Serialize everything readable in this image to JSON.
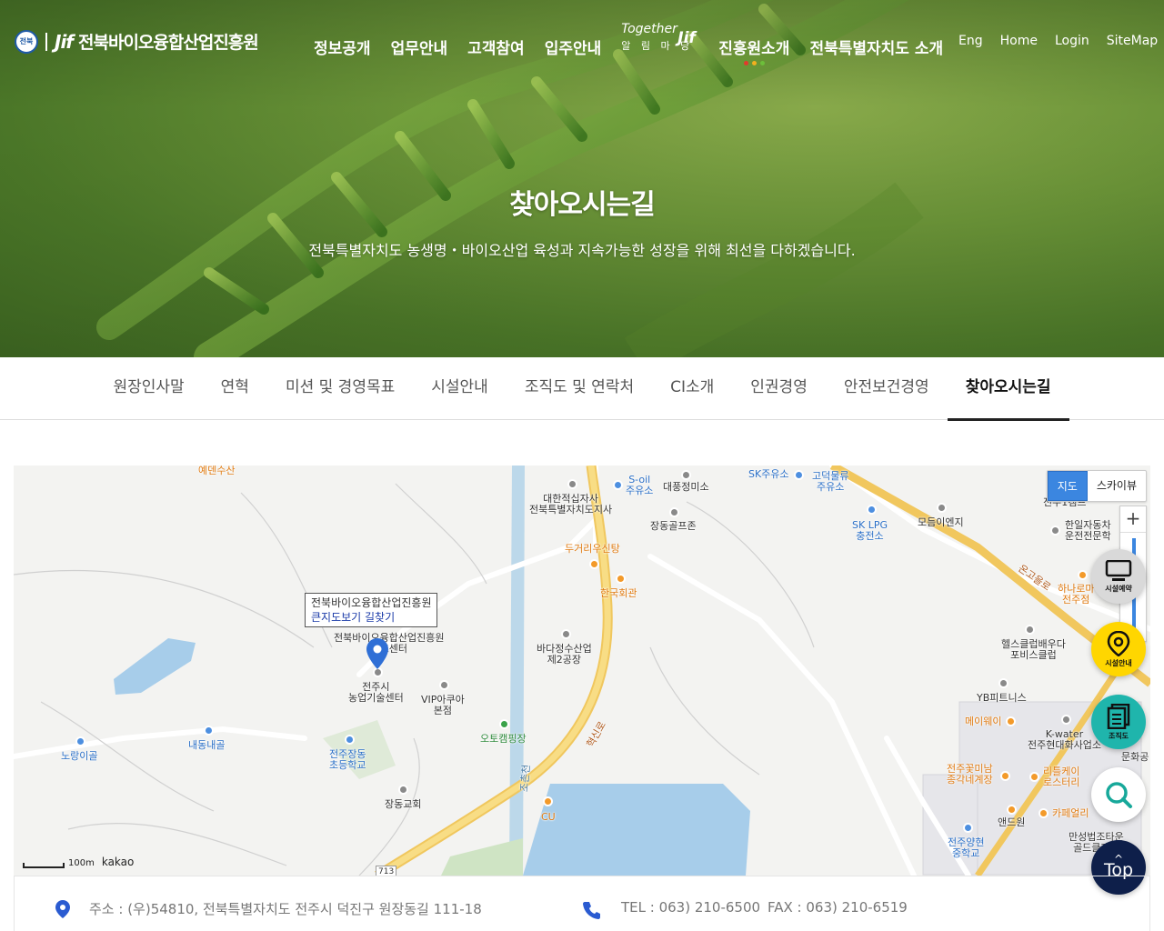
{
  "header": {
    "logo_seal": "전북",
    "logo_mark": "Jif",
    "org_name": "전북바이오융합산업진흥원",
    "gnb": [
      "정보공개",
      "업무안내",
      "고객참여",
      "입주안내"
    ],
    "together": {
      "line1": "Together",
      "line2": "알 림 마 당",
      "mark": "Jif"
    },
    "gnb_after": [
      "진흥원소개",
      "전북특별자치도 소개"
    ],
    "dot_colors": [
      "#e23a2c",
      "#f2b01e",
      "#6cbf3a"
    ],
    "util": [
      "Eng",
      "Home",
      "Login",
      "SiteMap"
    ]
  },
  "hero": {
    "title": "찾아오시는길",
    "subtitle": "전북특별자치도 농생명・바이오산업 육성과 지속가능한 성장을 위해 최선을 다하겠습니다."
  },
  "subnav": {
    "tabs": [
      "원장인사말",
      "연혁",
      "미션 및 경영목표",
      "시설안내",
      "조직도 및 연락처",
      "CI소개",
      "인권경영",
      "안전보건경영",
      "찾아오시는길"
    ],
    "active_index": 8
  },
  "map": {
    "infowindow": {
      "name": "전북바이오융합산업진흥원",
      "link": "큰지도보기 길찾기"
    },
    "labels": {
      "edensusan": "예덴수산",
      "redcross": "대한적십자사\n전북특별자치도지사",
      "soil": "S-oil\n주유소",
      "daepung": "대풍정미소",
      "skgas": "SK주유소",
      "godeok": "고덕물류\n주유소",
      "sklpg": "SK LPG\n충전소",
      "modeum": "모듬이엔지",
      "jangdong_prus": "장동골프존",
      "dugeori": "두거리우신탕",
      "hanguk": "한국회관",
      "bada": "바다정수산업\n제2공장",
      "jif_center": "전북바이오융합산업진흥원\n비즈센터",
      "jeonju_agri": "전주시\n농업기술센터",
      "vip": "VIP아쿠아\n본점",
      "noraengi": "노랑이골",
      "naedong": "내동내골",
      "jangdong_school": "전주장동\n초등학교",
      "autocamping": "오토캠핑장",
      "church": "장동교회",
      "cu": "CU",
      "hyeoksin": "혁신로",
      "jocheon": "조촌천",
      "route": "713",
      "hanil": "한일자동차\n운전전문학",
      "hanarumi": "하나로마\n전주점",
      "onggoeul": "온고을로",
      "healthclub": "헬스클럽배우다\n포비스클럽",
      "yb": "YB피트니스",
      "mayway": "메이웨이",
      "kwater": "K-water\n전주현대화사업소",
      "flower": "전주꽃미남\n종각네계장",
      "ritteukei": "리틀케이\n로스터리",
      "cafe": "카페얼리",
      "anderwon": "앤드원",
      "jeonju_middle": "전주양현\n중학교",
      "mansung": "만성법조타운\n골드클래스",
      "munhwa": "문화공",
      "jeonju1": "전주1캠프"
    },
    "maptype": [
      "지도",
      "스카이뷰"
    ],
    "zoom_plus": "+",
    "scale": "100m",
    "brand": "kakao"
  },
  "quick": [
    {
      "label": "시설예약",
      "color": "#d9d9d9"
    },
    {
      "label": "시설안내",
      "color": "#ffd600"
    },
    {
      "label": "조직도",
      "color": "#1fb5ac"
    },
    {
      "label": "",
      "color": "#ffffff"
    }
  ],
  "top_button": {
    "arrow": "^",
    "label": "Top"
  },
  "address": {
    "addr": "주소 : (우)54810, 전북특별자치도 전주시 덕진구 원장동길 111-18",
    "tel": "TEL : 063) 210-6500",
    "fax": "FAX : 063) 210-6519"
  }
}
